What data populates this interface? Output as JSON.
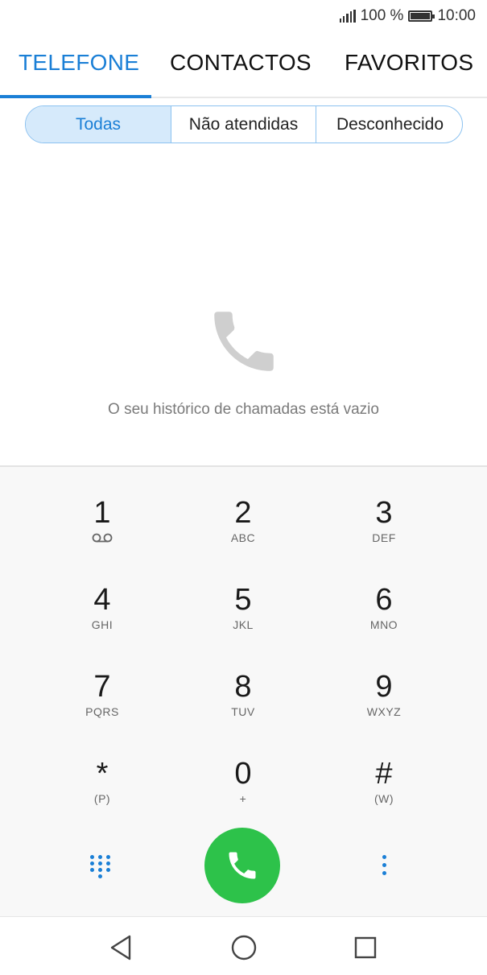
{
  "status_bar": {
    "battery": "100 %",
    "time": "10:00"
  },
  "tabs": [
    {
      "label": "TELEFONE",
      "active": true
    },
    {
      "label": "CONTACTOS",
      "active": false
    },
    {
      "label": "FAVORITOS",
      "active": false
    }
  ],
  "filters": [
    {
      "label": "Todas",
      "selected": true
    },
    {
      "label": "Não atendidas",
      "selected": false
    },
    {
      "label": "Desconhecido",
      "selected": false
    }
  ],
  "empty_state": {
    "message": "O seu histórico de chamadas está vazio",
    "icon": "phone-icon"
  },
  "dialpad": {
    "keys": [
      {
        "digit": "1",
        "letters": ""
      },
      {
        "digit": "2",
        "letters": "ABC"
      },
      {
        "digit": "3",
        "letters": "DEF"
      },
      {
        "digit": "4",
        "letters": "GHI"
      },
      {
        "digit": "5",
        "letters": "JKL"
      },
      {
        "digit": "6",
        "letters": "MNO"
      },
      {
        "digit": "7",
        "letters": "PQRS"
      },
      {
        "digit": "8",
        "letters": "TUV"
      },
      {
        "digit": "9",
        "letters": "WXYZ"
      },
      {
        "digit": "*",
        "letters": "(P)"
      },
      {
        "digit": "0",
        "letters": "+"
      },
      {
        "digit": "#",
        "letters": "(W)"
      }
    ]
  },
  "colors": {
    "accent": "#1a7fd6",
    "call_green": "#2dc24a"
  }
}
